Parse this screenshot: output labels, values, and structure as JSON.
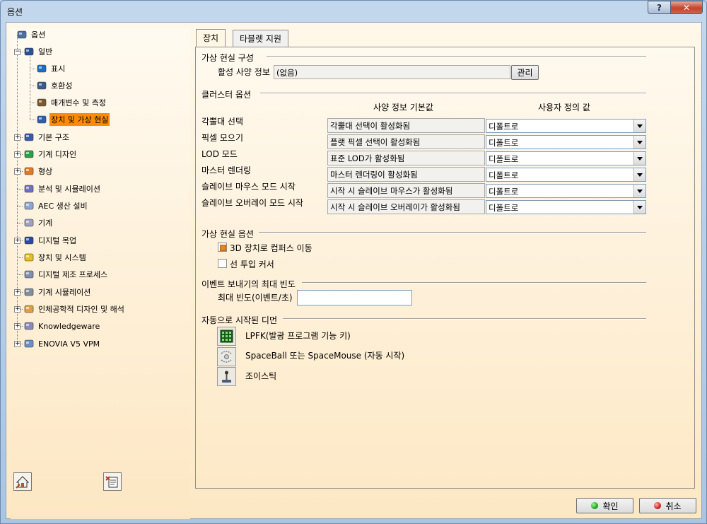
{
  "window": {
    "title": "옵션",
    "help_label": "?",
    "close_label": "✕"
  },
  "tree": {
    "items": [
      {
        "label": "옵션",
        "icon": "options-root-icon"
      },
      {
        "label": "일반",
        "icon": "general-icon"
      },
      {
        "label": "표시",
        "icon": "display-icon"
      },
      {
        "label": "호환성",
        "icon": "compatibility-icon"
      },
      {
        "label": "매개변수 및 측정",
        "icon": "parameters-measure-icon"
      },
      {
        "label": "장치 및 가상 현실",
        "icon": "devices-vr-icon"
      },
      {
        "label": "기본 구조",
        "icon": "infrastructure-icon"
      },
      {
        "label": "기계 디자인",
        "icon": "mechanical-design-icon"
      },
      {
        "label": "형상",
        "icon": "shape-icon"
      },
      {
        "label": "분석 및 시뮬레이션",
        "icon": "analysis-simulation-icon"
      },
      {
        "label": "AEC 생산 설비",
        "icon": "aec-plant-icon"
      },
      {
        "label": "기계",
        "icon": "machining-icon"
      },
      {
        "label": "디지털 목업",
        "icon": "digital-mockup-icon"
      },
      {
        "label": "장치 및 시스템",
        "icon": "equipment-systems-icon"
      },
      {
        "label": "디지털 제조 프로세스",
        "icon": "digital-process-icon"
      },
      {
        "label": "기계 시뮬레이션",
        "icon": "machining-simulation-icon"
      },
      {
        "label": "인체공학적 디자인 및 해석",
        "icon": "ergonomics-icon"
      },
      {
        "label": "Knowledgeware",
        "icon": "knowledgeware-icon"
      },
      {
        "label": "ENOVIA V5 VPM",
        "icon": "enovia-icon"
      }
    ],
    "selected": "장치 및 가상 현실",
    "bottom_buttons": [
      {
        "icon": "lock-settings-icon"
      },
      {
        "icon": "reset-settings-icon"
      }
    ]
  },
  "tabs": [
    {
      "label": "장치"
    },
    {
      "label": "타블렛 지원"
    }
  ],
  "vr_config": {
    "group_title": "가상 현실 구성",
    "active_profile_label": "활성 사양 정보",
    "active_profile_value": "(없음)",
    "manage_button": "관리"
  },
  "cluster": {
    "group_title": "클러스터 옵션",
    "col_default": "사양 정보 기본값",
    "col_user": "사용자 정의 값",
    "rows": [
      {
        "label": "각뿔대 선택",
        "default": "각뿔대 선택이 활성화됨",
        "user": "디폴트로"
      },
      {
        "label": "픽셀 모으기",
        "default": "플랫 픽셀 선택이 활성화됨",
        "user": "디폴트로"
      },
      {
        "label": "LOD 모드",
        "default": "표준 LOD가 활성화됨",
        "user": "디폴트로"
      },
      {
        "label": "마스터 렌더링",
        "default": "마스터 렌더링이 활성화됨",
        "user": "디폴트로"
      },
      {
        "label": "슬레이브 마우스 모드 시작",
        "default": "시작 시 슬레이브 마우스가 활성화됨",
        "user": "디폴트로"
      },
      {
        "label": "슬레이브 오버레이 모드 시작",
        "default": "시작 시 슬레이브 오버레이가 활성화됨",
        "user": "디폴트로"
      }
    ]
  },
  "vr_options": {
    "group_title": "가상 현실 옵션",
    "compass_label": "3D 장치로 컴퍼스 이동",
    "compass_checked": true,
    "cursor_label": "선 투입 커서",
    "cursor_checked": false
  },
  "event": {
    "group_title": "이벤트 보내기의 최대 빈도",
    "max_freq_label": "최대 빈도(이벤트/초)",
    "max_freq_value": ""
  },
  "devices": {
    "group_title": "자동으로 시작된 디먼",
    "items": [
      {
        "label": "LPFK(발광 프로그램 기능 키)",
        "icon": "lpfk-keypad-icon"
      },
      {
        "label": "SpaceBall 또는 SpaceMouse (자동 시작)",
        "icon": "spaceball-icon"
      },
      {
        "label": "조이스틱",
        "icon": "joystick-icon"
      }
    ]
  },
  "footer": {
    "ok_label": "확인",
    "cancel_label": "취소",
    "ok_color": "#1faa1f",
    "cancel_color": "#d62020"
  },
  "colors": {
    "selection": "#ff8c00",
    "panel_bg": "#fde9c7"
  }
}
